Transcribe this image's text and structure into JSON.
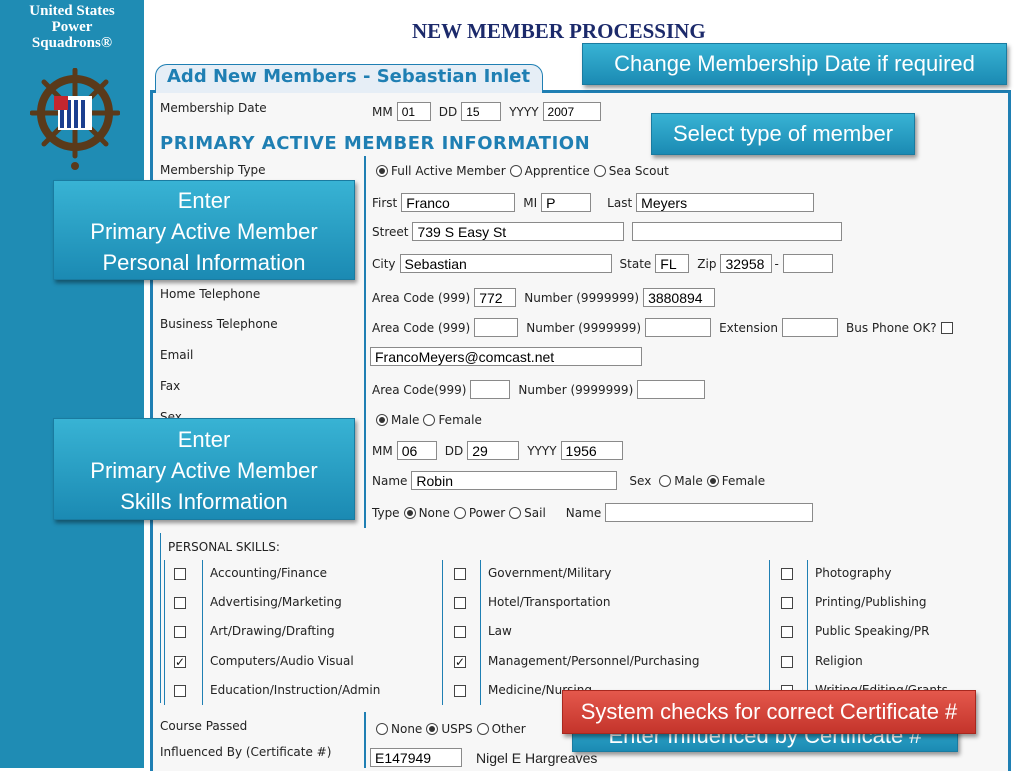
{
  "org": {
    "line1": "United States",
    "line2": "Power",
    "line3": "Squadrons®"
  },
  "title": "NEW MEMBER PROCESSING",
  "tab_label": "Add New Members - Sebastian Inlet",
  "callouts": {
    "membership_date": "Change Membership Date if required",
    "member_type": "Select type of member",
    "personal_info": [
      "Enter",
      "Primary Active Member",
      "Personal Information"
    ],
    "skills_info": [
      "Enter",
      "Primary Active Member",
      "Skills Information"
    ],
    "certificate_check": "System checks for correct Certificate #",
    "influenced_hidden": "Enter Influenced by Certificate #"
  },
  "membership_date": {
    "label": "Membership Date",
    "mm_label": "MM",
    "mm": "01",
    "dd_label": "DD",
    "dd": "15",
    "yyyy_label": "YYYY",
    "yyyy": "2007"
  },
  "section_title": "PRIMARY ACTIVE MEMBER INFORMATION",
  "membership_type": {
    "label": "Membership Type",
    "options": [
      "Full Active Member",
      "Apprentice",
      "Sea Scout"
    ],
    "selected": 0
  },
  "name": {
    "first_label": "First",
    "first": "Franco",
    "mi_label": "MI",
    "mi": "P",
    "last_label": "Last",
    "last": "Meyers"
  },
  "street": {
    "label": "Street",
    "value": "739 S Easy St",
    "value2": ""
  },
  "city": {
    "label": "City",
    "value": "Sebastian",
    "state_label": "State",
    "state": "FL",
    "zip_label": "Zip",
    "zip": "32958",
    "zip_ext": "",
    "dash": "-"
  },
  "home_phone": {
    "label": "Home Telephone",
    "area_label": "Area Code (999)",
    "area": "772",
    "number_label": "Number (9999999)",
    "number": "3880894"
  },
  "business_phone": {
    "label": "Business Telephone",
    "area_label": "Area Code (999)",
    "area": "",
    "number_label": "Number (9999999)",
    "number": "",
    "ext_label": "Extension",
    "ext": "",
    "ok_label": "Bus Phone OK?"
  },
  "email": {
    "label": "Email",
    "value": "FrancoMeyers@comcast.net"
  },
  "fax": {
    "label": "Fax",
    "area_label": "Area Code(999)",
    "area": "",
    "number_label": "Number (9999999)",
    "number": ""
  },
  "sex": {
    "label": "Sex",
    "options": [
      "Male",
      "Female"
    ],
    "selected": 0
  },
  "birth": {
    "mm_label": "MM",
    "mm": "06",
    "dd_label": "DD",
    "dd": "29",
    "yyyy_label": "YYYY",
    "yyyy": "1956"
  },
  "spouse": {
    "name_label": "Name",
    "name": "Robin",
    "sex_label": "Sex",
    "sex_options": [
      "Male",
      "Female"
    ],
    "sex_selected": 1
  },
  "boat": {
    "type_label": "Type",
    "options": [
      "None",
      "Power",
      "Sail"
    ],
    "selected": 0,
    "name_label": "Name",
    "name": ""
  },
  "skills": {
    "heading": "PERSONAL SKILLS:",
    "col1": [
      {
        "label": "Accounting/Finance",
        "checked": false
      },
      {
        "label": "Advertising/Marketing",
        "checked": false
      },
      {
        "label": "Art/Drawing/Drafting",
        "checked": false
      },
      {
        "label": "Computers/Audio Visual",
        "checked": true
      },
      {
        "label": "Education/Instruction/Admin",
        "checked": false
      }
    ],
    "col2": [
      {
        "label": "Government/Military",
        "checked": false
      },
      {
        "label": "Hotel/Transportation",
        "checked": false
      },
      {
        "label": "Law",
        "checked": false
      },
      {
        "label": "Management/Personnel/Purchasing",
        "checked": true
      },
      {
        "label": "Medicine/Nursing",
        "checked": false
      }
    ],
    "col3": [
      {
        "label": "Photography",
        "checked": false
      },
      {
        "label": "Printing/Publishing",
        "checked": false
      },
      {
        "label": "Public Speaking/PR",
        "checked": false
      },
      {
        "label": "Religion",
        "checked": false
      },
      {
        "label": "Writing/Editing/Grants",
        "checked": false
      }
    ]
  },
  "course": {
    "label": "Course Passed",
    "options": [
      "None",
      "USPS",
      "Other"
    ],
    "selected": 1
  },
  "influenced": {
    "label": "Influenced By (Certificate #)",
    "value": "E147949",
    "name": "Nigel E Hargreaves"
  },
  "colors": {
    "accent": "#1f7fb3",
    "callout": "#2a9fc8",
    "callout_red": "#d2453b",
    "title": "#1c2a6b"
  }
}
